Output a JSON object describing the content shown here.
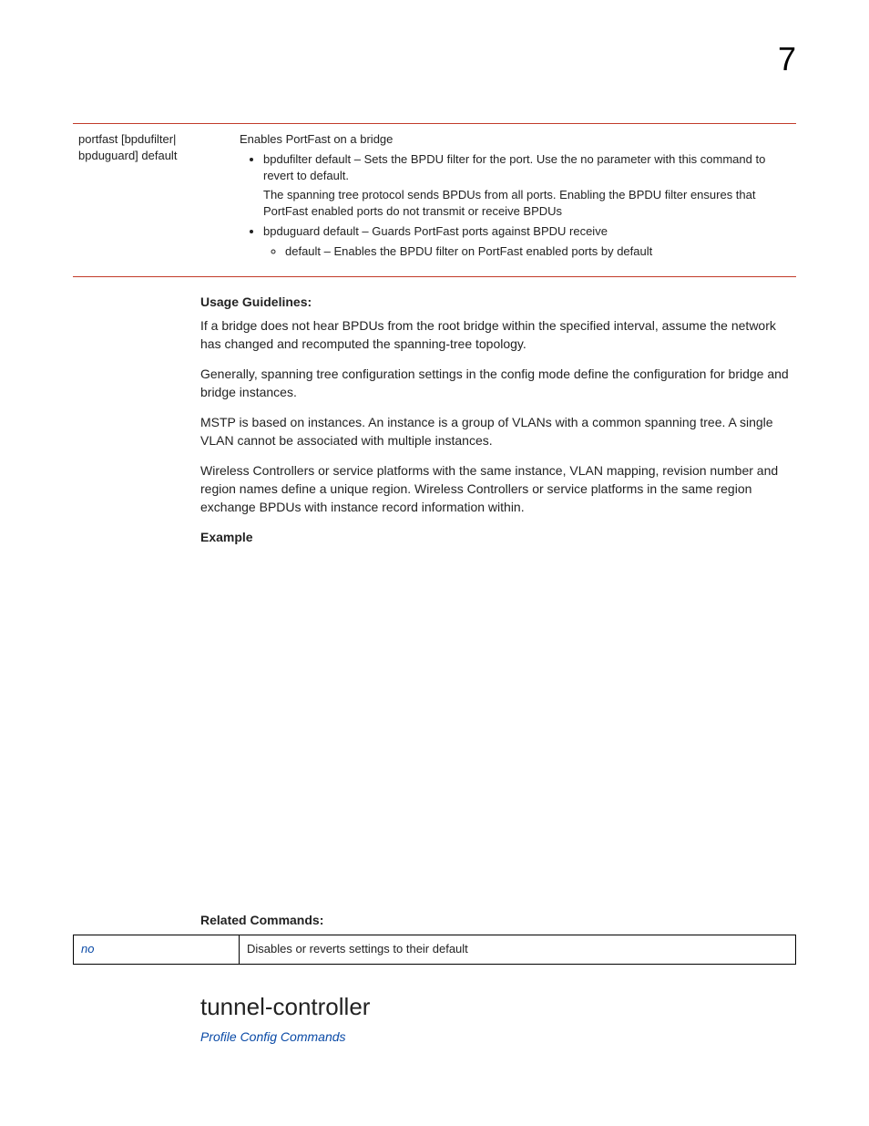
{
  "page_number": "7",
  "param": {
    "name_line1": "portfast [bpdufilter|",
    "name_line2": "bpduguard] default",
    "intro": "Enables PortFast on a bridge",
    "b1": "bpdufilter default – Sets the BPDU filter for the port. Use the no parameter with this command to revert to default.",
    "b1_note": "The spanning tree protocol sends BPDUs from all ports. Enabling the BPDU filter ensures that PortFast enabled ports do not transmit or receive BPDUs",
    "b2": "bpduguard default – Guards PortFast ports against BPDU receive",
    "b2_sub": "default – Enables the BPDU filter on PortFast enabled ports by default"
  },
  "usage": {
    "heading": "Usage Guidelines:",
    "p1": "If a bridge does not hear BPDUs from the root bridge within the specified interval, assume the network has changed and recomputed the spanning-tree topology.",
    "p2": "Generally, spanning tree configuration settings in the config mode define the configuration for bridge and bridge instances.",
    "p3": "MSTP is based on instances. An instance is a group of VLANs with a common spanning tree. A single VLAN cannot be associated with multiple instances.",
    "p4": "Wireless Controllers or service platforms with the same instance, VLAN mapping, revision number and region names define a unique region. Wireless Controllers or service platforms in the same region exchange BPDUs with instance record information within."
  },
  "example_heading": "Example",
  "related": {
    "heading": "Related Commands:",
    "cmd": "no",
    "desc": "Disables or reverts settings to their default"
  },
  "next_section": {
    "title": "tunnel-controller",
    "crumb": "Profile Config Commands"
  }
}
